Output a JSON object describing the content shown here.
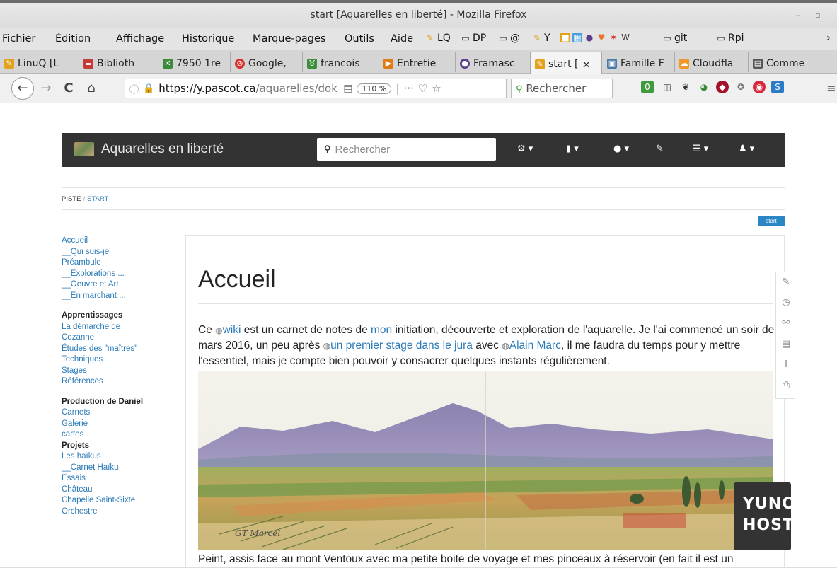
{
  "window": {
    "title": "start [Aquarelles en liberté] - Mozilla Firefox",
    "controls": [
      "–",
      "▫"
    ]
  },
  "menubar": {
    "items": [
      {
        "label": "Fichier"
      },
      {
        "label": "Édition"
      },
      {
        "label": "Affichage"
      },
      {
        "label": "Historique"
      },
      {
        "label": "Marque-pages"
      },
      {
        "label": "Outils"
      },
      {
        "label": "Aide"
      }
    ],
    "bookmarks": [
      {
        "label": "LQ",
        "icon": "linuq-icon"
      },
      {
        "label": "DP",
        "icon": "folder-icon"
      },
      {
        "label": "@",
        "icon": "folder-icon"
      },
      {
        "label": "Y",
        "icon": "linuq-icon"
      },
      {
        "label": "git",
        "icon": "folder-icon"
      },
      {
        "label": "Rpi",
        "icon": "folder-icon"
      }
    ],
    "overflow": "›"
  },
  "tabs": [
    {
      "label": "LinuQ [L",
      "icon_color": "#e2a21c"
    },
    {
      "label": "Biblioth",
      "icon_color": "#c33a3a"
    },
    {
      "label": "7950 1re",
      "icon_color": "#3d8a3d"
    },
    {
      "label": "Google,",
      "icon_color": "#d9302b"
    },
    {
      "label": "francois",
      "icon_color": "#3c8d3c"
    },
    {
      "label": "Entretie",
      "icon_color": "#e07b16"
    },
    {
      "label": "Framasc",
      "icon_color": "#5b3f8a"
    },
    {
      "label": "start [",
      "icon_color": "#e2a21c",
      "active": true,
      "close": "×"
    },
    {
      "label": "Famille F",
      "icon_color": "#4a79a8"
    },
    {
      "label": "Cloudfla",
      "icon_color": "#f0982a"
    },
    {
      "label": "Comme",
      "icon_color": "#555555"
    }
  ],
  "navbar": {
    "back": "←",
    "forward": "→",
    "reload": "C",
    "home": "⌂",
    "url_host": "https://y.pascot.ca",
    "url_path": "/aquarelles/dok",
    "zoom": "110 %",
    "more": "···",
    "search_placeholder": "Rechercher",
    "menu": "≡"
  },
  "site": {
    "brand": "Aquarelles en liberté",
    "search_placeholder": "Rechercher",
    "nav_icons": [
      "tools-icon",
      "file-icon",
      "tint-icon",
      "edit-icon",
      "list-icon",
      "user-icon"
    ]
  },
  "breadcrumb": {
    "trail_label": "PISTE",
    "current": "START"
  },
  "page_badge": "start",
  "sidebar": {
    "group1": [
      "Accueil",
      "__Qui suis-je",
      "Préambule",
      "__Explorations ...",
      "__Oeuvre et Art",
      "__En marchant ..."
    ],
    "heading2": "Apprentissages",
    "group2": [
      "La démarche de",
      "Cezanne",
      "Études des \"maîtres\"",
      "Techniques",
      "Stages",
      "Références"
    ],
    "heading3": "Production de Daniel",
    "group3": [
      "Carnets",
      "Galerie",
      "cartes"
    ],
    "heading4": "Projets",
    "group4": [
      "Les haïkus",
      "__Carnet Haïku",
      "Essais",
      "Château",
      "Chapelle Saint-Sixte",
      "Orchestre"
    ]
  },
  "content": {
    "title": "Accueil",
    "para": {
      "t1": "Ce ",
      "l1": "wiki",
      "t2": " est un carnet de notes de ",
      "l2": "mon",
      "t3": " initiation, découverte et exploration de l'aquarelle. Je l'ai commencé un soir de mars 2016, un peu après ",
      "l3": "un premier stage dans le jura",
      "t4": " avec ",
      "l4": "Alain Marc",
      "t5": ", il me faudra du temps pour y mettre l'essentiel, mais je compte bien pouvoir y consacrer quelques instants régulièrement."
    },
    "painting_signature": "GT Marcel",
    "caption": "Peint, assis face au mont Ventoux avec ma petite boite de voyage et mes pinceaux à réservoir (en fait il est un"
  },
  "page_tools": [
    "edit-icon",
    "history-icon",
    "backlinks-icon",
    "file-icon",
    "cursor-icon",
    "pdf-icon"
  ],
  "yunohost": {
    "line1": "YUNO",
    "line2": "HOST"
  }
}
